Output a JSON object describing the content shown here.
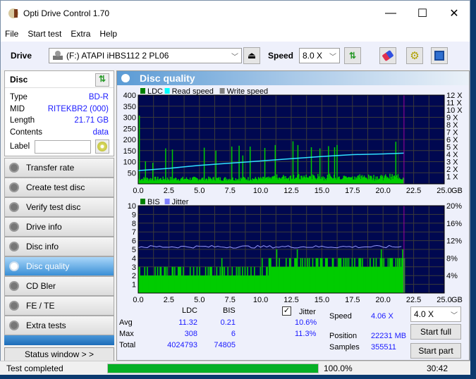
{
  "window": {
    "title": "Opti Drive Control 1.70",
    "controls": [
      "—",
      "☐",
      "✕"
    ]
  },
  "menu": [
    "File",
    "Start test",
    "Extra",
    "Help"
  ],
  "toolbar": {
    "drive_label": "Drive",
    "drive_value": "(F:)   ATAPI iHBS112   2 PL06",
    "speed_label": "Speed",
    "speed_value": "8.0 X"
  },
  "disc": {
    "title": "Disc",
    "rows": [
      {
        "k": "Type",
        "v": "BD-R"
      },
      {
        "k": "MID",
        "v": "RITEKBR2 (000)"
      },
      {
        "k": "Length",
        "v": "21.71 GB"
      },
      {
        "k": "Contents",
        "v": "data"
      }
    ],
    "label_key": "Label",
    "label_value": ""
  },
  "nav": [
    {
      "label": "Transfer rate",
      "active": false
    },
    {
      "label": "Create test disc",
      "active": false
    },
    {
      "label": "Verify test disc",
      "active": false
    },
    {
      "label": "Drive info",
      "active": false
    },
    {
      "label": "Disc info",
      "active": false
    },
    {
      "label": "Disc quality",
      "active": true
    },
    {
      "label": "CD Bler",
      "active": false
    },
    {
      "label": "FE / TE",
      "active": false
    },
    {
      "label": "Extra tests",
      "active": false
    }
  ],
  "status_window_label": "Status window > >",
  "main": {
    "title": "Disc quality"
  },
  "chart_data": [
    {
      "type": "bar",
      "title": "",
      "legend": [
        {
          "name": "LDC",
          "color": "#008000"
        },
        {
          "name": "Read speed",
          "color": "#00ffff"
        },
        {
          "name": "Write speed",
          "color": "#808080"
        }
      ],
      "legend_position": "top-left",
      "xlabel": "GB",
      "x_ticks": [
        "0.0",
        "2.5",
        "5.0",
        "7.5",
        "10.0",
        "12.5",
        "15.0",
        "17.5",
        "20.0",
        "22.5",
        "25.0"
      ],
      "xlim": [
        0,
        25
      ],
      "ylim": [
        0,
        400
      ],
      "y_ticks": [
        50,
        100,
        150,
        200,
        250,
        300,
        350,
        400
      ],
      "y2_ticks": [
        "1 X",
        "2 X",
        "3 X",
        "4 X",
        "5 X",
        "6 X",
        "7 X",
        "8 X",
        "9 X",
        "10 X",
        "11 X",
        "12 X"
      ],
      "y2lim": [
        0,
        12
      ],
      "disc_end_gb": 21.71,
      "ldc_baseline_avg": 22,
      "ldc_spikes": [
        [
          0.05,
          308
        ],
        [
          0.55,
          102
        ],
        [
          1.15,
          95
        ],
        [
          2.2,
          160
        ],
        [
          2.75,
          155
        ],
        [
          5.35,
          163
        ],
        [
          6.3,
          150
        ],
        [
          7.6,
          168
        ],
        [
          8.2,
          172
        ],
        [
          8.5,
          128
        ],
        [
          9.1,
          168
        ],
        [
          10.3,
          162
        ],
        [
          11.15,
          175
        ],
        [
          12.6,
          192
        ],
        [
          13.0,
          175
        ],
        [
          14.1,
          165
        ],
        [
          14.8,
          160
        ],
        [
          15.5,
          170
        ],
        [
          16.0,
          165
        ],
        [
          16.2,
          175
        ],
        [
          21.0,
          190
        ]
      ],
      "read_speed": [
        [
          0,
          1.8
        ],
        [
          2.5,
          2.1
        ],
        [
          5,
          2.5
        ],
        [
          7.5,
          2.8
        ],
        [
          10,
          3.1
        ],
        [
          12.5,
          3.4
        ],
        [
          15,
          3.7
        ],
        [
          17.5,
          3.95
        ],
        [
          20,
          4.05
        ],
        [
          21.7,
          4.15
        ]
      ]
    },
    {
      "type": "bar",
      "legend": [
        {
          "name": "BIS",
          "color": "#008000"
        },
        {
          "name": "Jitter",
          "color": "#8080ff"
        }
      ],
      "legend_position": "top-left",
      "xlabel": "GB",
      "x_ticks": [
        "0.0",
        "2.5",
        "5.0",
        "7.5",
        "10.0",
        "12.5",
        "15.0",
        "17.5",
        "20.0",
        "22.5",
        "25.0"
      ],
      "xlim": [
        0,
        25
      ],
      "ylim": [
        0,
        10
      ],
      "y_ticks": [
        1,
        2,
        3,
        4,
        5,
        6,
        7,
        8,
        9,
        10
      ],
      "y2_ticks": [
        "4%",
        "8%",
        "12%",
        "16%",
        "20%"
      ],
      "y2lim": [
        0,
        20
      ],
      "disc_end_gb": 21.71,
      "bis_base": 2,
      "bis_level3_start_gb": 10.6,
      "bis_max": 6,
      "jitter_avg_pct": 10.6
    }
  ],
  "stats": {
    "headers": [
      "LDC",
      "BIS"
    ],
    "jitter_label": "Jitter",
    "jitter_checked": true,
    "rows": [
      {
        "label": "Avg",
        "ldc": "11.32",
        "bis": "0.21",
        "jitter": "10.6%"
      },
      {
        "label": "Max",
        "ldc": "308",
        "bis": "6",
        "jitter": "11.3%"
      },
      {
        "label": "Total",
        "ldc": "4024793",
        "bis": "74805",
        "jitter": ""
      }
    ],
    "speed_label": "Speed",
    "speed_value": "4.06 X",
    "position_label": "Position",
    "position_value": "22231 MB",
    "samples_label": "Samples",
    "samples_value": "355511",
    "test_speed": "4.0 X",
    "start_full": "Start full",
    "start_part": "Start part"
  },
  "statusbar": {
    "text": "Test completed",
    "progress_pct": 100,
    "progress_text": "100.0%",
    "time": "30:42"
  },
  "colors": {
    "plot_bg": "#000850",
    "grid": "#3a3a3a",
    "ldc": "#00cc00",
    "read_speed": "#30e0ff",
    "jitter": "#9999ff",
    "end_marker": "#a000a0",
    "accent_blue": "#1a1aff"
  }
}
